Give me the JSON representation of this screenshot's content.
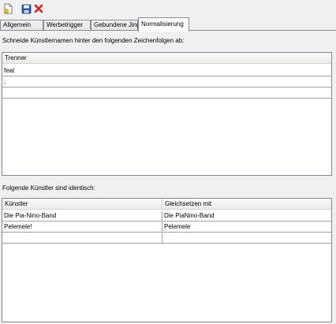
{
  "toolbar": {
    "new_icon": "new-document-icon",
    "save_icon": "save-disk-icon",
    "delete_icon": "red-x-delete-icon"
  },
  "tabs": [
    {
      "label": "Allgemein",
      "active": false
    },
    {
      "label": "Werbetrigger",
      "active": false
    },
    {
      "label": "Gebundene Jingles",
      "active": false
    },
    {
      "label": "Normalisierung",
      "active": true
    }
  ],
  "separators_section": {
    "label": "Schneide Künstlernamen hinter den folgenden Zeichenfolgen ab:",
    "column_header": "Trenner",
    "rows": [
      "feat",
      ";",
      ""
    ]
  },
  "identical_section": {
    "label": "Folgende Künstler sind identisch:",
    "columns": [
      "Künstler",
      "Gleichsetzen mit"
    ],
    "rows": [
      [
        "Die Pia-Nino-Band",
        "Die PiaNino-Band"
      ],
      [
        "Pelemele!",
        "Pelemele"
      ],
      [
        "",
        ""
      ]
    ]
  }
}
